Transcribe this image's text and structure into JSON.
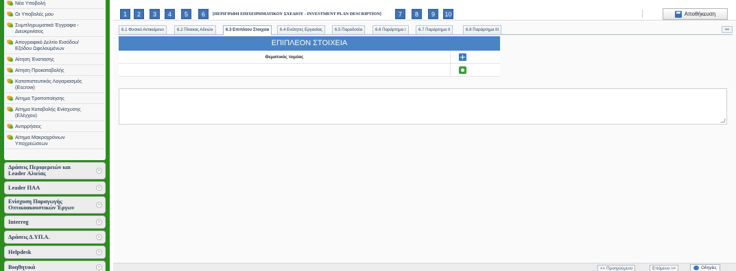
{
  "sidebar": {
    "items": [
      {
        "label": "Νέα Υποβολή",
        "cut": true
      },
      {
        "label": "Οι Υποβολές μου"
      },
      {
        "label": "Συμπληρωματικά Έγγραφα -",
        "sub": "Διευκρινίσεις"
      },
      {
        "label": "Απογραφικό Δελτίο Εισόδου/",
        "sub": "Εξόδου Ωφελουμένων"
      },
      {
        "label": "Αίτηση Ένστασης"
      },
      {
        "label": "Αίτηση Προκαταβολής"
      },
      {
        "label": "Καταπιστευτικός Λογαριασμός",
        "sub": "(Escrow)"
      },
      {
        "label": "Αίτημα Τροποποίησης"
      },
      {
        "label": "Αίτημα Καταβολής Ενίσχυσης",
        "sub": "(Ελέγχου)"
      },
      {
        "label": "Αντιρρήσεις"
      },
      {
        "label": "Αίτημα Μακροχρόνιων",
        "sub": "Υποχρεώσεων"
      }
    ],
    "sections": [
      {
        "label": "Δράσεις Περιφερειών και",
        "sub": "Leader Αλιείας"
      },
      {
        "label": "Leader ΠΑΑ"
      },
      {
        "label": "Ενίσχυση Παραγωγής",
        "sub": "Οπτικοακουστικών Έργων"
      },
      {
        "label": "Interreg"
      },
      {
        "label": "Δράσεις Δ.ΥΠ.Α."
      },
      {
        "label": "Helpdesk"
      },
      {
        "label": "Βοηθητικά"
      }
    ],
    "chevron": "»"
  },
  "topbar": {
    "steps": [
      "1",
      "2",
      "3",
      "4",
      "5",
      "6",
      "7",
      "8",
      "9",
      "10"
    ],
    "step_title": "[ΠΕΡΙΓΡΑΦΗ ΕΠΙΧΕΙΡΗΜΑΤΙΚΟΥ ΣΧΕΔΙΟΥ - INVESTMENT PLAN DESCRIPTION]",
    "save_label": "Αποθήκευση"
  },
  "tabs": {
    "items": [
      "6.1 Φυσικό Αντικείμενο",
      "6.2 Πίνακας Αδειών",
      "6.3 Επιπλέον Στοιχεία",
      "6.4 Ενότητες Εργασίας",
      "6.5 Παραδοτέα",
      "6.6 Παράρτημα Ι",
      "6.7 Παράρτημα ΙΙ",
      "6.8 Παράρτημα ΙΙΙ"
    ],
    "active_index": 2,
    "scroll_label": "◂ ▸"
  },
  "extra": {
    "header": "ΕΠΙΠΛΕΟΝ ΣΤΟΙΧΕΙΑ",
    "row_label": "Θεματικός τομέας"
  },
  "bottom": {
    "prev_label": "<< Προηγούμενο",
    "next_label": "Επόμενο >>",
    "help_label": "Οδηγίες"
  },
  "colors": {
    "sidebar_green": "#2e8b1f",
    "step_blue": "#3f73b4",
    "header_blue": "#4a84c4"
  }
}
